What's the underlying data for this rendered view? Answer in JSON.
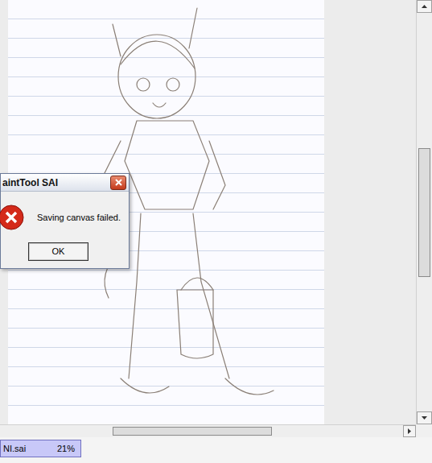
{
  "dialog": {
    "title": "aintTool SAI",
    "message": "Saving canvas failed.",
    "buttons": [
      "OK"
    ]
  },
  "status_bar": {
    "documents": [
      {
        "name": "NI.sai",
        "zoom": "21%",
        "selected": true
      }
    ]
  }
}
